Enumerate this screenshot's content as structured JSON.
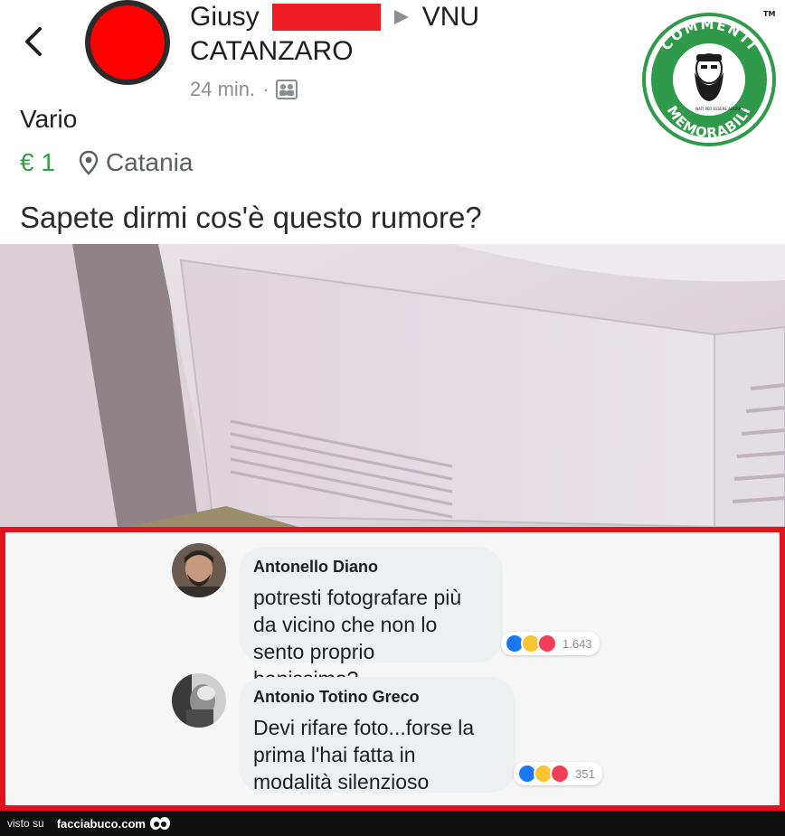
{
  "post": {
    "author_first_name": "Giusy",
    "group_name": "VNU",
    "location_header": "CATANZARO",
    "time": "24 min.",
    "meta_separator": "·",
    "category": "Vario",
    "price": "€ 1",
    "place": "Catania",
    "text": "Sapete dirmi cos'è questo rumore?"
  },
  "watermark": {
    "top_text": "COMMENTI",
    "bottom_text": "MEMORABILI",
    "tm": "TM",
    "sub_text": "NATI PER ESSERE ADORATI",
    "color": "#2e9a4a"
  },
  "comments": [
    {
      "name": "Antonello Diano",
      "text": "potresti fotografare più\nda vicino che non lo\nsento proprio benissimo?",
      "reaction_count": "1.643"
    },
    {
      "name": "Antonio Totino Greco",
      "text": "Devi rifare foto...forse la\nprima l'hai fatta in\nmodalità silenzioso",
      "reaction_count": "351"
    }
  ],
  "footer": {
    "prefix": "visto su",
    "site": "facciabuco.com"
  },
  "colors": {
    "highlight_border": "#e0141e",
    "price_green": "#2e9f3e",
    "like_blue": "#1877f2",
    "haha_yellow": "#f7c531",
    "love_red": "#f33e58"
  }
}
